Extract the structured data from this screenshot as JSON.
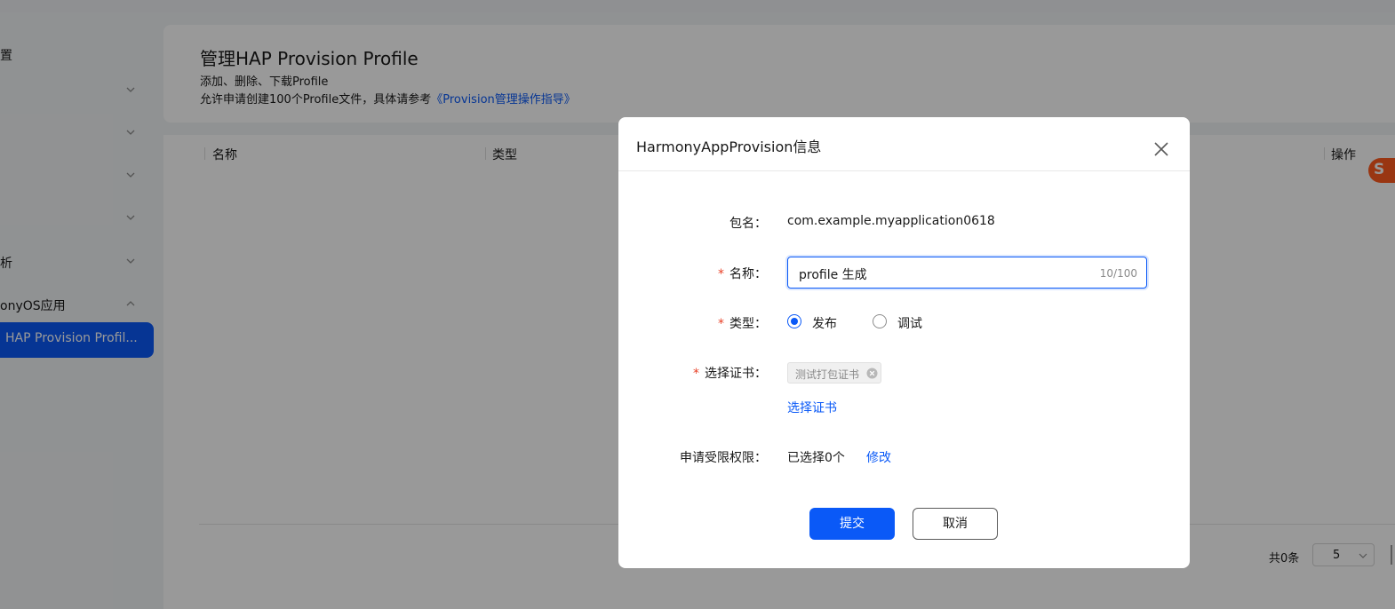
{
  "sidebar": {
    "items": [
      {
        "label": "置"
      },
      {
        "label": ""
      },
      {
        "label": ""
      },
      {
        "label": ""
      },
      {
        "label": ""
      },
      {
        "label": "析"
      },
      {
        "label": "onyOS应用"
      },
      {
        "label": "HAP Provision Profil..."
      }
    ]
  },
  "header": {
    "title": "管理HAP Provision Profile",
    "sub1": "添加、删除、下载Profile",
    "sub2_text": "允许申请创建100个Profile文件，具体请参考",
    "sub2_link": "《Provision管理操作指导》"
  },
  "table": {
    "columns": [
      "名称",
      "类型",
      "操作"
    ],
    "total": "共0条",
    "page_size": "5"
  },
  "ime": {
    "logo": "S"
  },
  "dialog": {
    "title": "HarmonyAppProvision信息",
    "package_label": "包名：",
    "package_value": "com.example.myapplication0618",
    "name_label": "名称：",
    "name_value": "profile 生成",
    "name_count": "10/100",
    "type_label": "类型：",
    "type_options": [
      "发布",
      "调试"
    ],
    "type_selected": "发布",
    "cert_label": "选择证书：",
    "cert_tag": "测试打包证书",
    "cert_link": "选择证书",
    "perm_label": "申请受限权限：",
    "perm_value": "已选择0个",
    "perm_link": "修改",
    "submit": "提交",
    "cancel": "取消",
    "required_mark": "*",
    "accent": "#0a59f7",
    "required_color": "#e84026"
  }
}
